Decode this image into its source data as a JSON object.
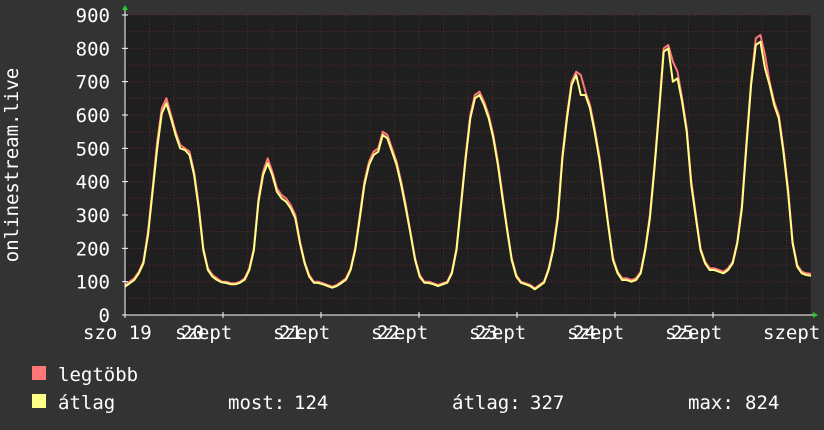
{
  "chart_data": {
    "type": "area",
    "ylabel": "onlinestream.live",
    "ylim": [
      0,
      900
    ],
    "yticks": [
      0,
      100,
      200,
      300,
      400,
      500,
      600,
      700,
      800,
      900
    ],
    "x_tick_labels": [
      "szo 19",
      "szept",
      "20",
      "szept",
      "21",
      "szept",
      "22",
      "szept",
      "23",
      "szept",
      "24",
      "szept",
      "25",
      "szept"
    ],
    "grid": true,
    "legend_placement": "bottom-left",
    "colors": {
      "background": "#333333",
      "plot_background": "#1f1f1f",
      "grid": "#5a2a2a",
      "axis": "#ffffff",
      "axis_arrow": "#22cc22",
      "max_series": "#ff7777",
      "avg_series": "#ffff88"
    },
    "series": [
      {
        "name": "legtöbb",
        "values": [
          90,
          100,
          110,
          130,
          160,
          250,
          380,
          520,
          620,
          650,
          600,
          550,
          510,
          500,
          490,
          430,
          330,
          200,
          140,
          120,
          110,
          100,
          100,
          95,
          95,
          100,
          110,
          140,
          200,
          350,
          430,
          470,
          430,
          380,
          360,
          350,
          330,
          300,
          220,
          160,
          120,
          100,
          100,
          95,
          90,
          85,
          90,
          100,
          110,
          140,
          200,
          300,
          400,
          460,
          490,
          500,
          550,
          540,
          500,
          460,
          400,
          330,
          250,
          170,
          120,
          100,
          100,
          95,
          90,
          95,
          100,
          130,
          200,
          340,
          480,
          600,
          660,
          670,
          640,
          600,
          540,
          460,
          360,
          260,
          170,
          120,
          100,
          95,
          90,
          80,
          90,
          100,
          140,
          200,
          300,
          480,
          600,
          700,
          730,
          720,
          670,
          630,
          560,
          480,
          380,
          270,
          170,
          130,
          110,
          110,
          105,
          110,
          130,
          200,
          300,
          450,
          620,
          800,
          810,
          760,
          730,
          650,
          560,
          400,
          300,
          200,
          160,
          140,
          140,
          135,
          130,
          140,
          160,
          220,
          330,
          520,
          700,
          830,
          840,
          780,
          700,
          640,
          600,
          500,
          380,
          220,
          150,
          130,
          125,
          124
        ]
      },
      {
        "name": "átlag",
        "values": [
          85,
          95,
          105,
          125,
          155,
          240,
          370,
          500,
          605,
          635,
          590,
          540,
          500,
          495,
          480,
          420,
          320,
          195,
          135,
          115,
          105,
          98,
          96,
          92,
          92,
          97,
          106,
          135,
          195,
          340,
          420,
          455,
          420,
          370,
          350,
          340,
          320,
          290,
          215,
          155,
          115,
          97,
          96,
          92,
          87,
          82,
          87,
          96,
          106,
          135,
          195,
          290,
          390,
          450,
          480,
          490,
          540,
          530,
          490,
          450,
          390,
          320,
          245,
          165,
          115,
          97,
          96,
          92,
          87,
          92,
          97,
          125,
          195,
          330,
          470,
          590,
          650,
          660,
          630,
          590,
          530,
          450,
          350,
          255,
          165,
          115,
          97,
          92,
          87,
          77,
          87,
          97,
          135,
          195,
          290,
          470,
          590,
          690,
          720,
          660,
          660,
          620,
          550,
          470,
          370,
          265,
          165,
          125,
          105,
          105,
          100,
          105,
          125,
          195,
          290,
          440,
          610,
          790,
          800,
          700,
          710,
          640,
          550,
          390,
          290,
          195,
          155,
          135,
          135,
          130,
          125,
          135,
          155,
          215,
          320,
          510,
          690,
          810,
          820,
          740,
          690,
          630,
          590,
          490,
          370,
          215,
          145,
          125,
          120,
          118
        ]
      }
    ],
    "stats": {
      "most_label": "most:",
      "most_value": "124",
      "avg_label": "átlag:",
      "avg_value": "327",
      "max_label": "max:",
      "max_value": "824"
    }
  }
}
